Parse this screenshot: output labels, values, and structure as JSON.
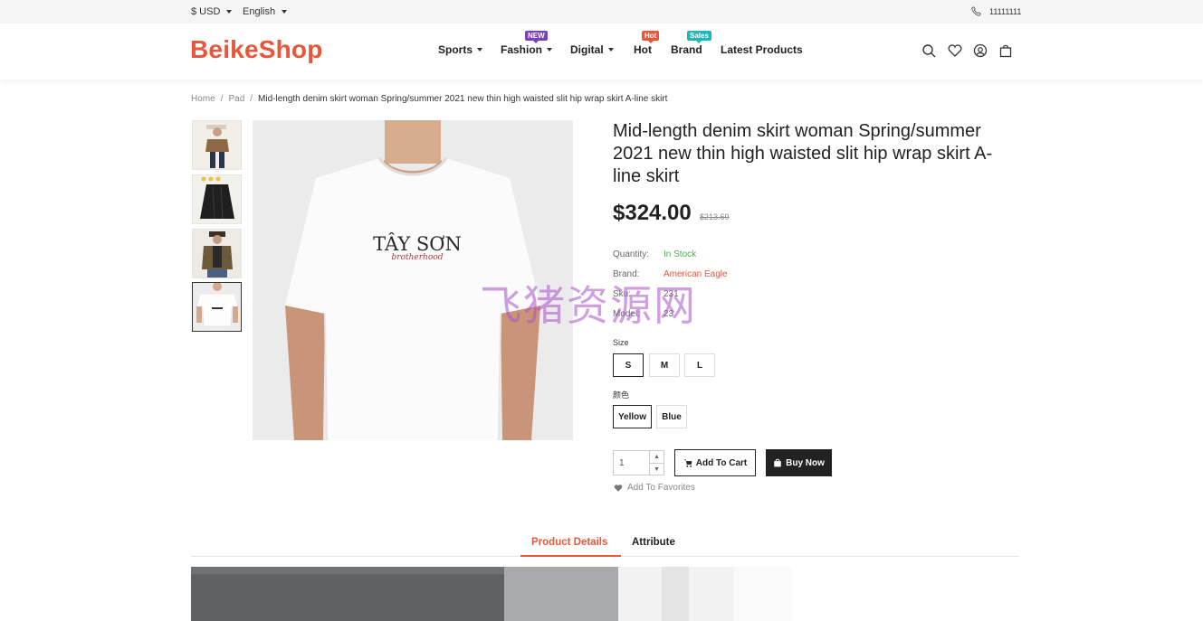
{
  "topbar": {
    "currency": "$ USD",
    "language": "English",
    "phone": "11111111"
  },
  "header": {
    "logo": "BeikeShop",
    "nav": [
      {
        "label": "Sports",
        "dropdown": true,
        "badge": ""
      },
      {
        "label": "Fashion",
        "dropdown": true,
        "badge": "NEW",
        "badge_color": "#7b3fb8"
      },
      {
        "label": "Digital",
        "dropdown": true,
        "badge": ""
      },
      {
        "label": "Hot",
        "dropdown": false,
        "badge": "Hot",
        "badge_color": "#e8573a"
      },
      {
        "label": "Brand",
        "dropdown": false,
        "badge": "Sales",
        "badge_color": "#21b5b5"
      },
      {
        "label": "Latest Products",
        "dropdown": false,
        "badge": ""
      }
    ],
    "icons": [
      "search-icon",
      "heart-icon",
      "user-icon",
      "cart-icon"
    ]
  },
  "breadcrumb": {
    "home": "Home",
    "category": "Pad",
    "current": "Mid-length denim skirt woman Spring/summer 2021 new thin high waisted slit hip wrap skirt A-line skirt"
  },
  "product": {
    "title": "Mid-length denim skirt woman Spring/summer 2021 new thin high waisted slit hip wrap skirt A-line skirt",
    "price": "$324.00",
    "old_price": "$213.69",
    "image_text": "TÂY SƠN",
    "image_subtext": "brotherhood",
    "meta": {
      "quantity_label": "Quantity:",
      "quantity_value": "In Stock",
      "brand_label": "Brand:",
      "brand_value": "American Eagle",
      "sku_label": "Sku:",
      "sku_value": "231",
      "model_label": "Model:",
      "model_value": "23"
    },
    "size_label": "Size",
    "sizes": [
      "S",
      "M",
      "L"
    ],
    "color_label": "颜色",
    "colors": [
      "Yellow",
      "Blue"
    ],
    "qty_value": "1",
    "add_to_cart": "Add To Cart",
    "buy_now": "Buy Now",
    "add_to_favorites": "Add To Favorites"
  },
  "tabs": {
    "details": "Product Details",
    "attribute": "Attribute"
  },
  "watermark": "飞猪资源网",
  "colors": {
    "accent": "#e8573a",
    "in_stock": "#4caf50",
    "dark": "#222222"
  }
}
